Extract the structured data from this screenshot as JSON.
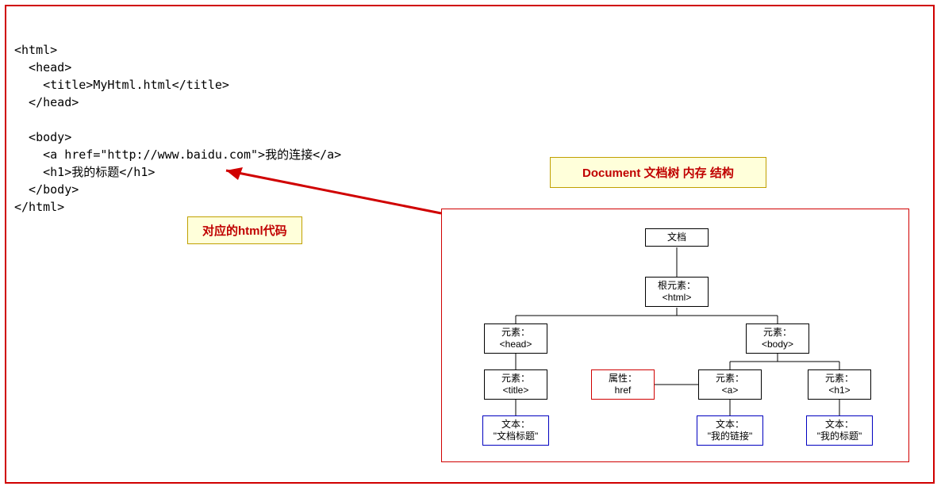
{
  "code": {
    "line1": "<html>",
    "line2": "  <head>",
    "line3": "    <title>MyHtml.html</title>",
    "line4": "  </head>",
    "line5_blank": "",
    "line6": "  <body>",
    "line7": "    <a href=\"http://www.baidu.com\">我的连接</a>",
    "line8": "    <h1>我的标题</h1>",
    "line9": "  </body>",
    "line10": "</html>"
  },
  "labels": {
    "code_callout": "对应的html代码",
    "tree_callout": "Document 文档树 内存 结构"
  },
  "tree": {
    "doc": {
      "l1": "文档"
    },
    "root": {
      "l1": "根元素：",
      "l2": "<html>"
    },
    "head": {
      "l1": "元素：",
      "l2": "<head>"
    },
    "body": {
      "l1": "元素：",
      "l2": "<body>"
    },
    "title": {
      "l1": "元素：",
      "l2": "<title>"
    },
    "title_text": {
      "l1": "文本：",
      "l2": "\"文档标题\""
    },
    "attr": {
      "l1": "属性：",
      "l2": "href"
    },
    "a": {
      "l1": "元素：",
      "l2": "<a>"
    },
    "a_text": {
      "l1": "文本：",
      "l2": "\"我的链接\""
    },
    "h1": {
      "l1": "元素：",
      "l2": "<h1>"
    },
    "h1_text": {
      "l1": "文本：",
      "l2": "\"我的标题\""
    }
  }
}
